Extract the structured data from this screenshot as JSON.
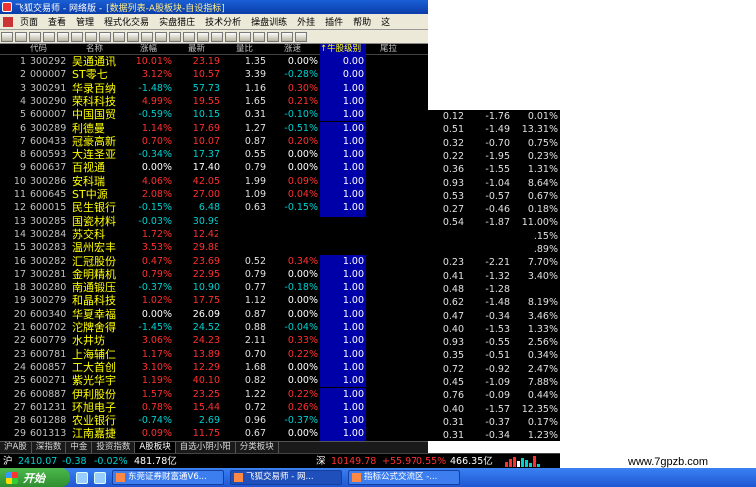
{
  "window": {
    "title": "飞狐交易师 - 网络版 -",
    "subtitle": "[数据列表-A股板块-自设指标]"
  },
  "menu": [
    "页面",
    "查看",
    "管理",
    "程式化交易",
    "实盘猎庄",
    "技术分析",
    "操盘训练",
    "外挂",
    "插件",
    "帮助",
    "这"
  ],
  "columns": [
    "代码",
    "名称",
    "涨幅",
    "最新",
    "量比",
    "涨速",
    "↑牛股级别",
    "尾拉"
  ],
  "rows": [
    {
      "idx": "1",
      "code": "300292",
      "name": "吴通通讯",
      "chg": "10.01%",
      "price": "23.19",
      "vr": "1.35",
      "spd": "0.00%",
      "score": "0.00"
    },
    {
      "idx": "2",
      "code": "000007",
      "name": "ST零七",
      "chg": "3.12%",
      "price": "10.57",
      "vr": "3.39",
      "spd": "-0.28%",
      "score": "0.00"
    },
    {
      "idx": "3",
      "code": "300291",
      "name": "华录百纳",
      "chg": "-1.48%",
      "price": "57.73",
      "vr": "1.16",
      "spd": "0.30%",
      "score": "1.00"
    },
    {
      "idx": "4",
      "code": "300290",
      "name": "荣科科技",
      "chg": "4.99%",
      "price": "19.55",
      "vr": "1.65",
      "spd": "0.21%",
      "score": "1.00"
    },
    {
      "idx": "5",
      "code": "600007",
      "name": "中国国贸",
      "chg": "-0.59%",
      "price": "10.15",
      "vr": "0.31",
      "spd": "-0.10%",
      "score": "1.00"
    },
    {
      "idx": "6",
      "code": "300289",
      "name": "利德曼",
      "chg": "1.14%",
      "price": "17.69",
      "vr": "1.27",
      "spd": "-0.51%",
      "score": "1.00"
    },
    {
      "idx": "7",
      "code": "600433",
      "name": "冠豪高新",
      "chg": "0.70%",
      "price": "10.07",
      "vr": "0.87",
      "spd": "0.20%",
      "score": "1.00"
    },
    {
      "idx": "8",
      "code": "600593",
      "name": "大连圣亚",
      "chg": "-0.34%",
      "price": "17.37",
      "vr": "0.55",
      "spd": "0.00%",
      "score": "1.00"
    },
    {
      "idx": "9",
      "code": "600637",
      "name": "百视通",
      "chg": "0.00%",
      "price": "17.40",
      "vr": "0.79",
      "spd": "0.00%",
      "score": "1.00"
    },
    {
      "idx": "10",
      "code": "300286",
      "name": "安科瑞",
      "chg": "4.06%",
      "price": "42.05",
      "vr": "1.99",
      "spd": "0.09%",
      "score": "1.00"
    },
    {
      "idx": "11",
      "code": "600645",
      "name": "ST中源",
      "chg": "2.08%",
      "price": "27.00",
      "vr": "1.09",
      "spd": "0.04%",
      "score": "1.00"
    },
    {
      "idx": "12",
      "code": "600015",
      "name": "民生银行",
      "chg": "-0.15%",
      "price": "6.48",
      "vr": "0.63",
      "spd": "-0.15%",
      "score": "1.00"
    },
    {
      "idx": "13",
      "code": "300285",
      "name": "国瓷材料",
      "chg": "-0.03%",
      "price": "30.99",
      "vr": "1.30",
      "spd": "-0.13%",
      "score": "1.00"
    },
    {
      "idx": "14",
      "code": "300284",
      "name": "苏交科",
      "chg": "1.72%",
      "price": "12.42",
      "vr": "",
      "spd": "",
      "score": ""
    },
    {
      "idx": "15",
      "code": "300283",
      "name": "温州宏丰",
      "chg": "3.53%",
      "price": "29.88",
      "vr": "",
      "spd": "",
      "score": ""
    },
    {
      "idx": "16",
      "code": "300282",
      "name": "汇冠股份",
      "chg": "0.47%",
      "price": "23.69",
      "vr": "0.52",
      "spd": "0.34%",
      "score": "1.00"
    },
    {
      "idx": "17",
      "code": "300281",
      "name": "金明精机",
      "chg": "0.79%",
      "price": "22.95",
      "vr": "0.79",
      "spd": "0.00%",
      "score": "1.00"
    },
    {
      "idx": "18",
      "code": "300280",
      "name": "南通锻压",
      "chg": "-0.37%",
      "price": "10.90",
      "vr": "0.77",
      "spd": "-0.18%",
      "score": "1.00"
    },
    {
      "idx": "19",
      "code": "300279",
      "name": "和晶科技",
      "chg": "1.02%",
      "price": "17.75",
      "vr": "1.12",
      "spd": "0.00%",
      "score": "1.00"
    },
    {
      "idx": "20",
      "code": "600340",
      "name": "华夏幸福",
      "chg": "0.00%",
      "price": "26.09",
      "vr": "0.87",
      "spd": "0.00%",
      "score": "1.00"
    },
    {
      "idx": "21",
      "code": "600702",
      "name": "沱牌舍得",
      "chg": "-1.45%",
      "price": "24.52",
      "vr": "0.88",
      "spd": "-0.04%",
      "score": "1.00"
    },
    {
      "idx": "22",
      "code": "600779",
      "name": "水井坊",
      "chg": "3.06%",
      "price": "24.23",
      "vr": "2.11",
      "spd": "0.33%",
      "score": "1.00"
    },
    {
      "idx": "23",
      "code": "600781",
      "name": "上海辅仁",
      "chg": "1.17%",
      "price": "13.89",
      "vr": "0.70",
      "spd": "0.22%",
      "score": "1.00"
    },
    {
      "idx": "24",
      "code": "600857",
      "name": "工大首创",
      "chg": "3.10%",
      "price": "12.29",
      "vr": "1.68",
      "spd": "0.00%",
      "score": "1.00"
    },
    {
      "idx": "25",
      "code": "600271",
      "name": "紫光华宇",
      "chg": "1.19%",
      "price": "40.10",
      "vr": "0.82",
      "spd": "0.00%",
      "score": "1.00"
    },
    {
      "idx": "26",
      "code": "600887",
      "name": "伊利股份",
      "chg": "1.57%",
      "price": "23.25",
      "vr": "1.22",
      "spd": "0.22%",
      "score": "1.00"
    },
    {
      "idx": "27",
      "code": "601231",
      "name": "环旭电子",
      "chg": "0.78%",
      "price": "15.44",
      "vr": "0.72",
      "spd": "0.26%",
      "score": "1.00"
    },
    {
      "idx": "28",
      "code": "601288",
      "name": "农业银行",
      "chg": "-0.74%",
      "price": "2.69",
      "vr": "0.96",
      "spd": "-0.37%",
      "score": "1.00"
    },
    {
      "idx": "29",
      "code": "601313",
      "name": "江南嘉捷",
      "chg": "0.09%",
      "price": "11.75",
      "vr": "0.67",
      "spd": "0.00%",
      "score": "1.00"
    }
  ],
  "extra_rows": [
    {
      "a": "0.12",
      "b": "-1.76",
      "c": "0.01%"
    },
    {
      "a": "0.51",
      "b": "-1.49",
      "c": "13.31%"
    },
    {
      "a": "0.32",
      "c2": "",
      "b": "-0.70",
      "c": "0.75%"
    },
    {
      "a": "0.22",
      "b": "-1.95",
      "c": "0.23%"
    },
    {
      "a": "0.36",
      "b": "-1.55",
      "c": "1.31%"
    },
    {
      "a": "0.93",
      "b": "-1.04",
      "c": "8.64%"
    },
    {
      "a": "0.53",
      "b": "-0.57",
      "c": "0.67%"
    },
    {
      "a": "0.27",
      "b": "-0.46",
      "c": "0.18%"
    },
    {
      "a": "0.54",
      "b": "-1.87",
      "c": "11.00%"
    },
    {
      "a": "",
      "b": "",
      "c": ".15%"
    },
    {
      "a": "",
      "b": "",
      "c": ".89%"
    },
    {
      "a": "0.23",
      "b": "-2.21",
      "c": "7.70%"
    },
    {
      "a": "0.41",
      "b": "-1.32",
      "c": "3.40%"
    },
    {
      "a": "0.48",
      "b": "-1.28",
      "c": ""
    },
    {
      "a": "0.62",
      "b": "-1.48",
      "c": "8.19%"
    },
    {
      "a": "0.47",
      "b": "-0.34",
      "c": "3.46%"
    },
    {
      "a": "0.40",
      "b": "-1.53",
      "c": "1.33%"
    },
    {
      "a": "0.93",
      "b": "-0.55",
      "c": "2.56%"
    },
    {
      "a": "0.35",
      "b": "-0.51",
      "c": "0.34%"
    },
    {
      "a": "0.72",
      "b": "-0.92",
      "c": "2.47%"
    },
    {
      "a": "0.45",
      "b": "-1.09",
      "c": "7.88%"
    },
    {
      "a": "0.76",
      "b": "-0.09",
      "c": "0.44%"
    },
    {
      "a": "0.40",
      "b": "-1.57",
      "c": "12.35%"
    },
    {
      "a": "0.31",
      "b": "-0.37",
      "c": "0.17%"
    },
    {
      "a": "0.31",
      "b": "-0.34",
      "c": "1.23%"
    }
  ],
  "tabs": [
    "沪A股",
    "深指数",
    "中金",
    "投资指数",
    "A股板块",
    "自选小阴小阳",
    "分类板块"
  ],
  "status": {
    "sh_label": "沪",
    "sh_index": "2410.07",
    "sh_change": "-0.38",
    "sh_pct": "-0.02%",
    "sh_amount": "481.78亿",
    "sz_label": "深",
    "sz_index": "10149.78",
    "sz_change": "+55.97",
    "sz_pct": "0.55%",
    "sz_amount": "466.35亿"
  },
  "taskbar": {
    "start": "开始",
    "tasks": [
      "东莞证券财富通V6...",
      "飞狐交易师 - 网...",
      "指标公式交流区 -..."
    ]
  },
  "watermark": "www.7gpzb.com",
  "colors": {
    "up": "#ff3030",
    "down": "#00d0d0",
    "name": "#ffff00",
    "score_bg": "#0000a8"
  }
}
